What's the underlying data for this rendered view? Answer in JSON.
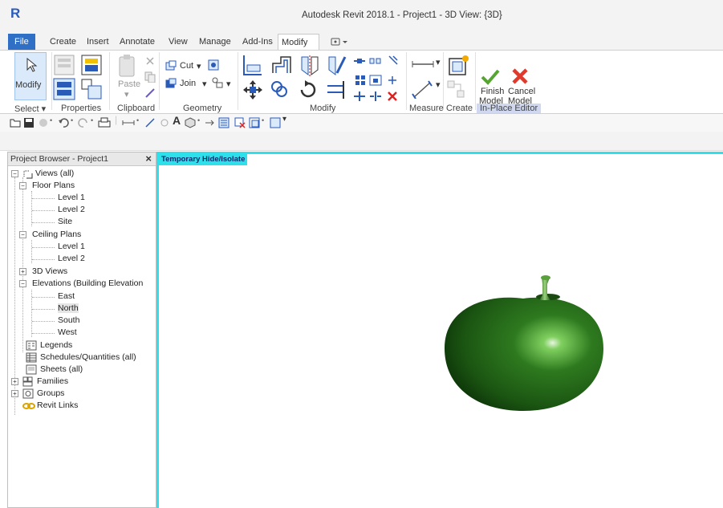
{
  "app": {
    "logo": "R",
    "window_title": "Autodesk Revit 2018.1 -    Project1 - 3D View: {3D}"
  },
  "ribbon_tabs": [
    {
      "label": "File"
    },
    {
      "label": "Create"
    },
    {
      "label": "Insert"
    },
    {
      "label": "Annotate"
    },
    {
      "label": "View"
    },
    {
      "label": "Manage"
    },
    {
      "label": "Add-Ins"
    },
    {
      "label": "Modify"
    }
  ],
  "active_tab": "Modify",
  "ribbon": {
    "modify_label": "Modify",
    "paste_label": "Paste",
    "cut_label": "Cut",
    "join_label": "Join",
    "finish_label_1": "Finish",
    "finish_label_2": "Model",
    "cancel_label_1": "Cancel",
    "cancel_label_2": "Model",
    "panels": {
      "select": "Select ▾",
      "properties": "Properties",
      "clipboard": "Clipboard",
      "geometry": "Geometry",
      "modify": "Modify",
      "measure": "Measure",
      "create": "Create",
      "in_place_editor": "In-Place Editor"
    }
  },
  "project_browser": {
    "title": "Project Browser - Project1",
    "close": "×",
    "items": [
      {
        "label": "Views (all)"
      },
      {
        "label": "Floor Plans"
      },
      {
        "label": "Level 1"
      },
      {
        "label": "Level 2"
      },
      {
        "label": "Site"
      },
      {
        "label": "Ceiling Plans"
      },
      {
        "label": "Level 1"
      },
      {
        "label": "Level 2"
      },
      {
        "label": "3D Views"
      },
      {
        "label": "Elevations (Building Elevation"
      },
      {
        "label": "East"
      },
      {
        "label": "North"
      },
      {
        "label": "South"
      },
      {
        "label": "West"
      },
      {
        "label": "Legends"
      },
      {
        "label": "Schedules/Quantities (all)"
      },
      {
        "label": "Sheets (all)"
      },
      {
        "label": "Families"
      },
      {
        "label": "Groups"
      },
      {
        "label": "Revit Links"
      }
    ]
  },
  "viewport": {
    "banner": "Temporary Hide/Isolate"
  },
  "colors": {
    "file_tab": "#2f6fc6",
    "isolate_border": "#2de0ea",
    "apple_green": "#2e7a1f",
    "finish_check": "#55a630",
    "cancel_x": "#e03a2c"
  }
}
